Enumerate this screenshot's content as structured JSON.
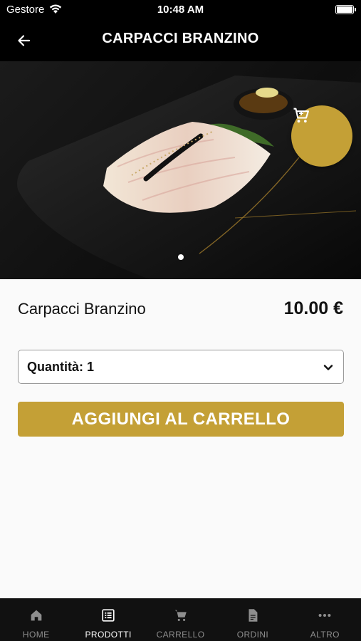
{
  "status_bar": {
    "carrier": "Gestore",
    "time": "10:48 AM"
  },
  "header": {
    "title": "CARPACCI BRANZINO"
  },
  "product": {
    "name": "Carpacci Branzino",
    "price": "10.00 €",
    "quantity_label": "Quantità: 1",
    "add_to_cart_label": "AGGIUNGI AL CARRELLO",
    "image_pages": 1,
    "image_current_page": 1
  },
  "colors": {
    "accent": "#c4a036",
    "header_bg": "#000000",
    "tab_bar_bg": "#111111",
    "tab_inactive": "#8e8e8e",
    "tab_active": "#ffffff"
  },
  "tab_bar": {
    "items": [
      {
        "label": "HOME",
        "icon": "home-icon",
        "active": false
      },
      {
        "label": "PRODOTTI",
        "icon": "list-icon",
        "active": true
      },
      {
        "label": "CARRELLO",
        "icon": "cart-icon",
        "active": false
      },
      {
        "label": "ORDINI",
        "icon": "document-icon",
        "active": false
      },
      {
        "label": "ALTRO",
        "icon": "more-icon",
        "active": false
      }
    ]
  }
}
